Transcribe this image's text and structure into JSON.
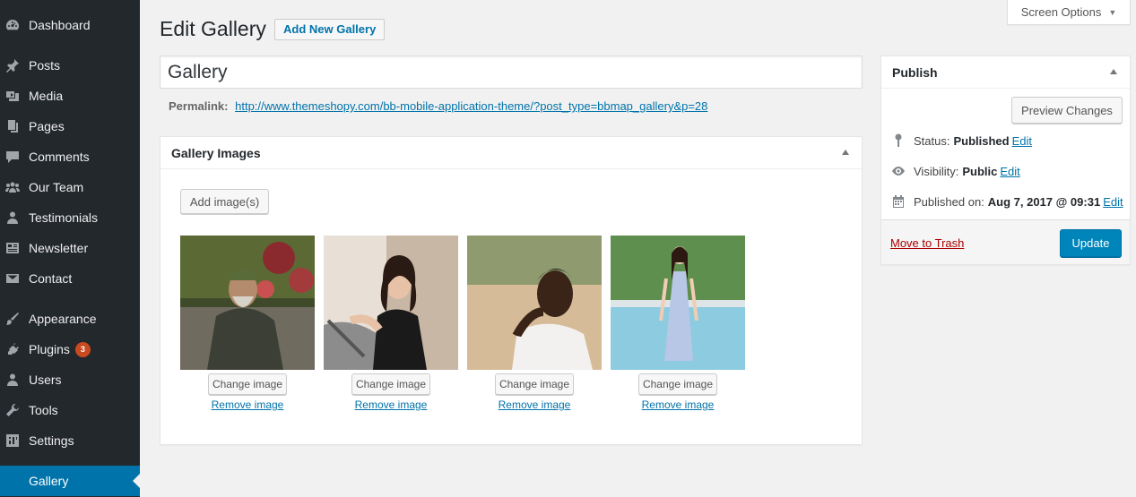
{
  "sidebar": {
    "items": [
      {
        "label": "Dashboard",
        "icon": "dashboard-icon"
      },
      {
        "label": "Posts",
        "icon": "pin-icon"
      },
      {
        "label": "Media",
        "icon": "media-icon"
      },
      {
        "label": "Pages",
        "icon": "pages-icon"
      },
      {
        "label": "Comments",
        "icon": "comment-icon"
      },
      {
        "label": "Our Team",
        "icon": "groups-icon"
      },
      {
        "label": "Testimonials",
        "icon": "user-icon"
      },
      {
        "label": "Newsletter",
        "icon": "newsletter-icon"
      },
      {
        "label": "Contact",
        "icon": "email-icon"
      },
      {
        "label": "Appearance",
        "icon": "paintbrush-icon"
      },
      {
        "label": "Plugins",
        "icon": "plugin-icon",
        "badge": "3"
      },
      {
        "label": "Users",
        "icon": "users-icon"
      },
      {
        "label": "Tools",
        "icon": "wrench-icon"
      },
      {
        "label": "Settings",
        "icon": "settings-icon"
      },
      {
        "label": "Gallery",
        "icon": "",
        "current": true
      }
    ]
  },
  "screen_options": {
    "label": "Screen Options"
  },
  "header": {
    "title": "Edit Gallery",
    "add_new": "Add New Gallery"
  },
  "post": {
    "title_value": "Gallery",
    "permalink_label": "Permalink:",
    "permalink_url": "http://www.themeshopy.com/bb-mobile-application-theme/?post_type=bbmap_gallery&p=28"
  },
  "gallery_box": {
    "title": "Gallery Images",
    "add_button": "Add image(s)",
    "change_label": "Change image",
    "remove_label": "Remove image",
    "images": [
      {
        "name": "elderly-man-in-green-cap-photo"
      },
      {
        "name": "woman-in-black-lace-top-photo"
      },
      {
        "name": "man-in-white-shirt-thinking-photo"
      },
      {
        "name": "woman-in-blue-dress-by-pool-photo"
      }
    ]
  },
  "publish": {
    "title": "Publish",
    "preview": "Preview Changes",
    "status_label": "Status:",
    "status_value": "Published",
    "visibility_label": "Visibility:",
    "visibility_value": "Public",
    "published_label": "Published on:",
    "published_value": "Aug 7, 2017 @ 09:31",
    "edit": "Edit",
    "trash": "Move to Trash",
    "update": "Update"
  },
  "colors": {
    "sidebar_bg": "#23282d",
    "accent": "#0073aa",
    "primary_button": "#0085ba",
    "trash": "#a00",
    "badge": "#ca4a1f"
  }
}
